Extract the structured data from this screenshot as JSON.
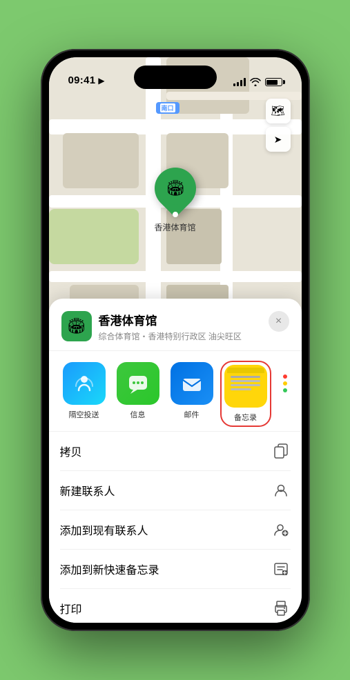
{
  "status_bar": {
    "time": "09:41",
    "location_arrow": "▶"
  },
  "map": {
    "label_text": "南口",
    "pin_label": "香港体育馆",
    "pin_emoji": "🏟"
  },
  "venue": {
    "name": "香港体育馆",
    "subtitle": "综合体育馆・香港特别行政区 油尖旺区",
    "icon_emoji": "🏟"
  },
  "share_apps": [
    {
      "id": "airdrop",
      "label": "隔空投送"
    },
    {
      "id": "messages",
      "label": "信息"
    },
    {
      "id": "mail",
      "label": "邮件"
    },
    {
      "id": "notes",
      "label": "备忘录"
    }
  ],
  "actions": [
    {
      "id": "copy",
      "label": "拷贝",
      "icon": "📋"
    },
    {
      "id": "new-contact",
      "label": "新建联系人",
      "icon": "👤"
    },
    {
      "id": "add-existing",
      "label": "添加到现有联系人",
      "icon": "👤"
    },
    {
      "id": "quick-note",
      "label": "添加到新快速备忘录",
      "icon": "📝"
    },
    {
      "id": "print",
      "label": "打印",
      "icon": "🖨"
    }
  ],
  "buttons": {
    "close_label": "×"
  }
}
